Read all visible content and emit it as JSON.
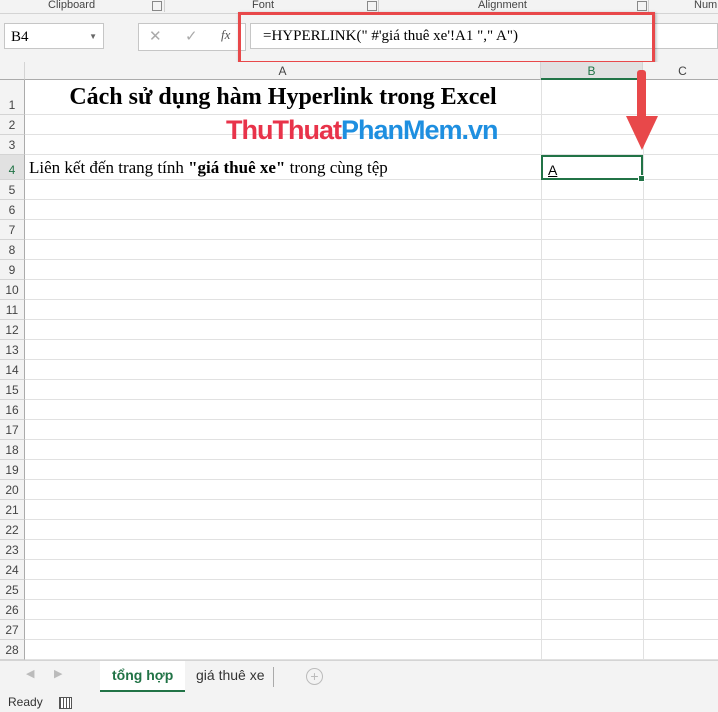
{
  "ribbon": {
    "groups": [
      "Clipboard",
      "Font",
      "Alignment",
      "Num"
    ]
  },
  "formula_bar": {
    "name_box": "B4",
    "cancel_icon": "✕",
    "enter_icon": "✓",
    "fx_label": "fx",
    "formula": "=HYPERLINK(\" #'giá thuê xe'!A1 \",\" A\")"
  },
  "columns": [
    "A",
    "B",
    "C"
  ],
  "rows": [
    "1",
    "2",
    "3",
    "4",
    "5",
    "6",
    "7",
    "8",
    "9",
    "10",
    "11",
    "12",
    "13",
    "14",
    "15",
    "16",
    "17",
    "18",
    "19",
    "20",
    "21",
    "22",
    "23",
    "24",
    "25",
    "26",
    "27",
    "28"
  ],
  "cells": {
    "A1": "Cách sử dụng hàm Hyperlink trong Excel",
    "A4_pre": "Liên kết đến trang tính ",
    "A4_bold": "\"giá thuê xe\"",
    "A4_post": " trong cùng tệp",
    "B4": "A"
  },
  "watermark": {
    "part1": "ThuThuat",
    "part2": "PhanMem",
    "part3": ".vn",
    "color1": "#e8334a",
    "color2": "#1e8fe0"
  },
  "sheets": {
    "active": "tổng hợp",
    "other": "giá thuê xe"
  },
  "status": {
    "text": "Ready"
  },
  "colors": {
    "accent": "#217346",
    "highlight": "#e8484a"
  }
}
